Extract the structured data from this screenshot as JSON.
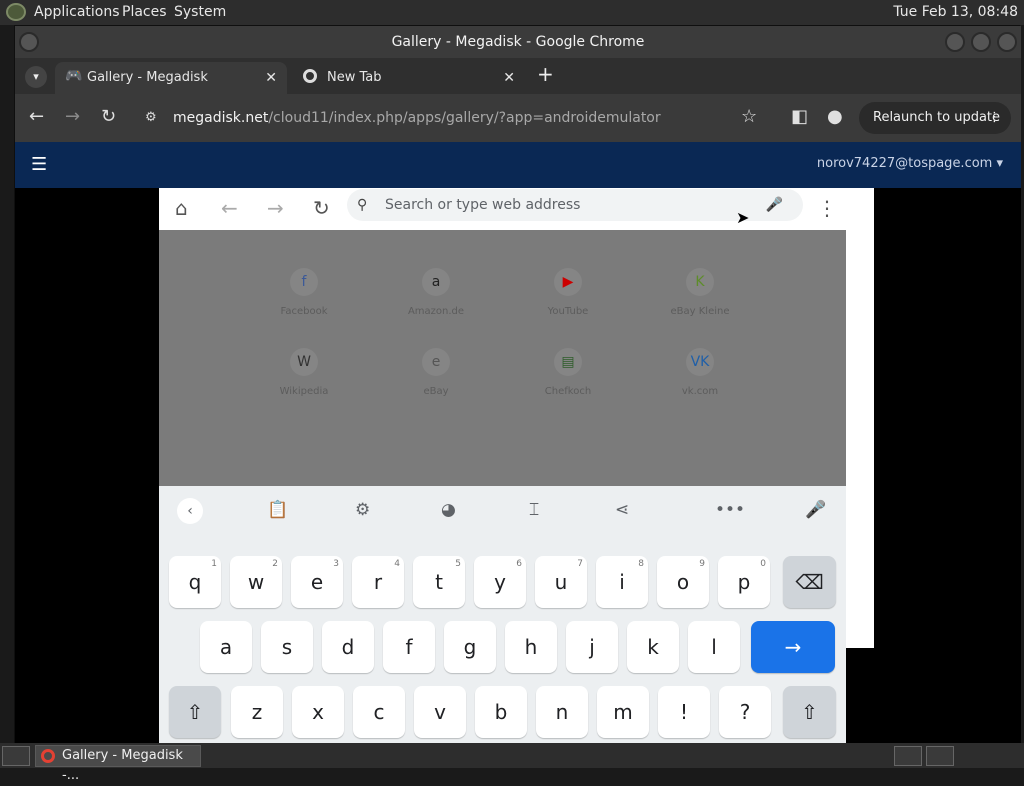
{
  "top_panel": {
    "menus": [
      "Applications",
      "Places",
      "System"
    ],
    "clock": "Tue Feb 13, 08:48"
  },
  "window": {
    "title": "Gallery - Megadisk - Google Chrome"
  },
  "tabs": [
    {
      "label": "Gallery - Megadisk",
      "close": "✕",
      "icon": "gamepad-icon"
    },
    {
      "label": "New Tab",
      "close": "✕",
      "icon": "chrome-icon"
    }
  ],
  "toolbar": {
    "url_host": "megadisk.net",
    "url_path": "/cloud11/index.php/apps/gallery/?app=androidemulator",
    "relaunch_label": "Relaunch to update"
  },
  "app_header": {
    "user": "norov74227@tospage.com ▾"
  },
  "emulator": {
    "search_placeholder": "Search or type web address",
    "shortcuts": [
      {
        "label": "Facebook",
        "glyph": "f",
        "color": "#3b5998"
      },
      {
        "label": "Amazon.de",
        "glyph": "a",
        "color": "#222222"
      },
      {
        "label": "YouTube",
        "glyph": "▶",
        "color": "#cc0000"
      },
      {
        "label": "eBay Kleine",
        "glyph": "K",
        "color": "#5d8c2a"
      },
      {
        "label": "Wikipedia",
        "glyph": "W",
        "color": "#333333"
      },
      {
        "label": "eBay",
        "glyph": "e",
        "color": "#555555"
      },
      {
        "label": "Chefkoch",
        "glyph": "▤",
        "color": "#2e5d2a"
      },
      {
        "label": "vk.com",
        "glyph": "VK",
        "color": "#1f5fa8"
      }
    ],
    "keyboard": {
      "row1": [
        [
          "q",
          "1"
        ],
        [
          "w",
          "2"
        ],
        [
          "e",
          "3"
        ],
        [
          "r",
          "4"
        ],
        [
          "t",
          "5"
        ],
        [
          "y",
          "6"
        ],
        [
          "u",
          "7"
        ],
        [
          "i",
          "8"
        ],
        [
          "o",
          "9"
        ],
        [
          "p",
          "0"
        ]
      ],
      "row2": [
        "a",
        "s",
        "d",
        "f",
        "g",
        "h",
        "j",
        "k",
        "l"
      ],
      "row3": [
        "z",
        "x",
        "c",
        "v",
        "b",
        "n",
        "m",
        "!",
        "?"
      ],
      "backspace": "⌫",
      "enter": "→",
      "shift": "⇧"
    }
  },
  "taskbar": {
    "item_label": "Gallery - Megadisk -..."
  }
}
